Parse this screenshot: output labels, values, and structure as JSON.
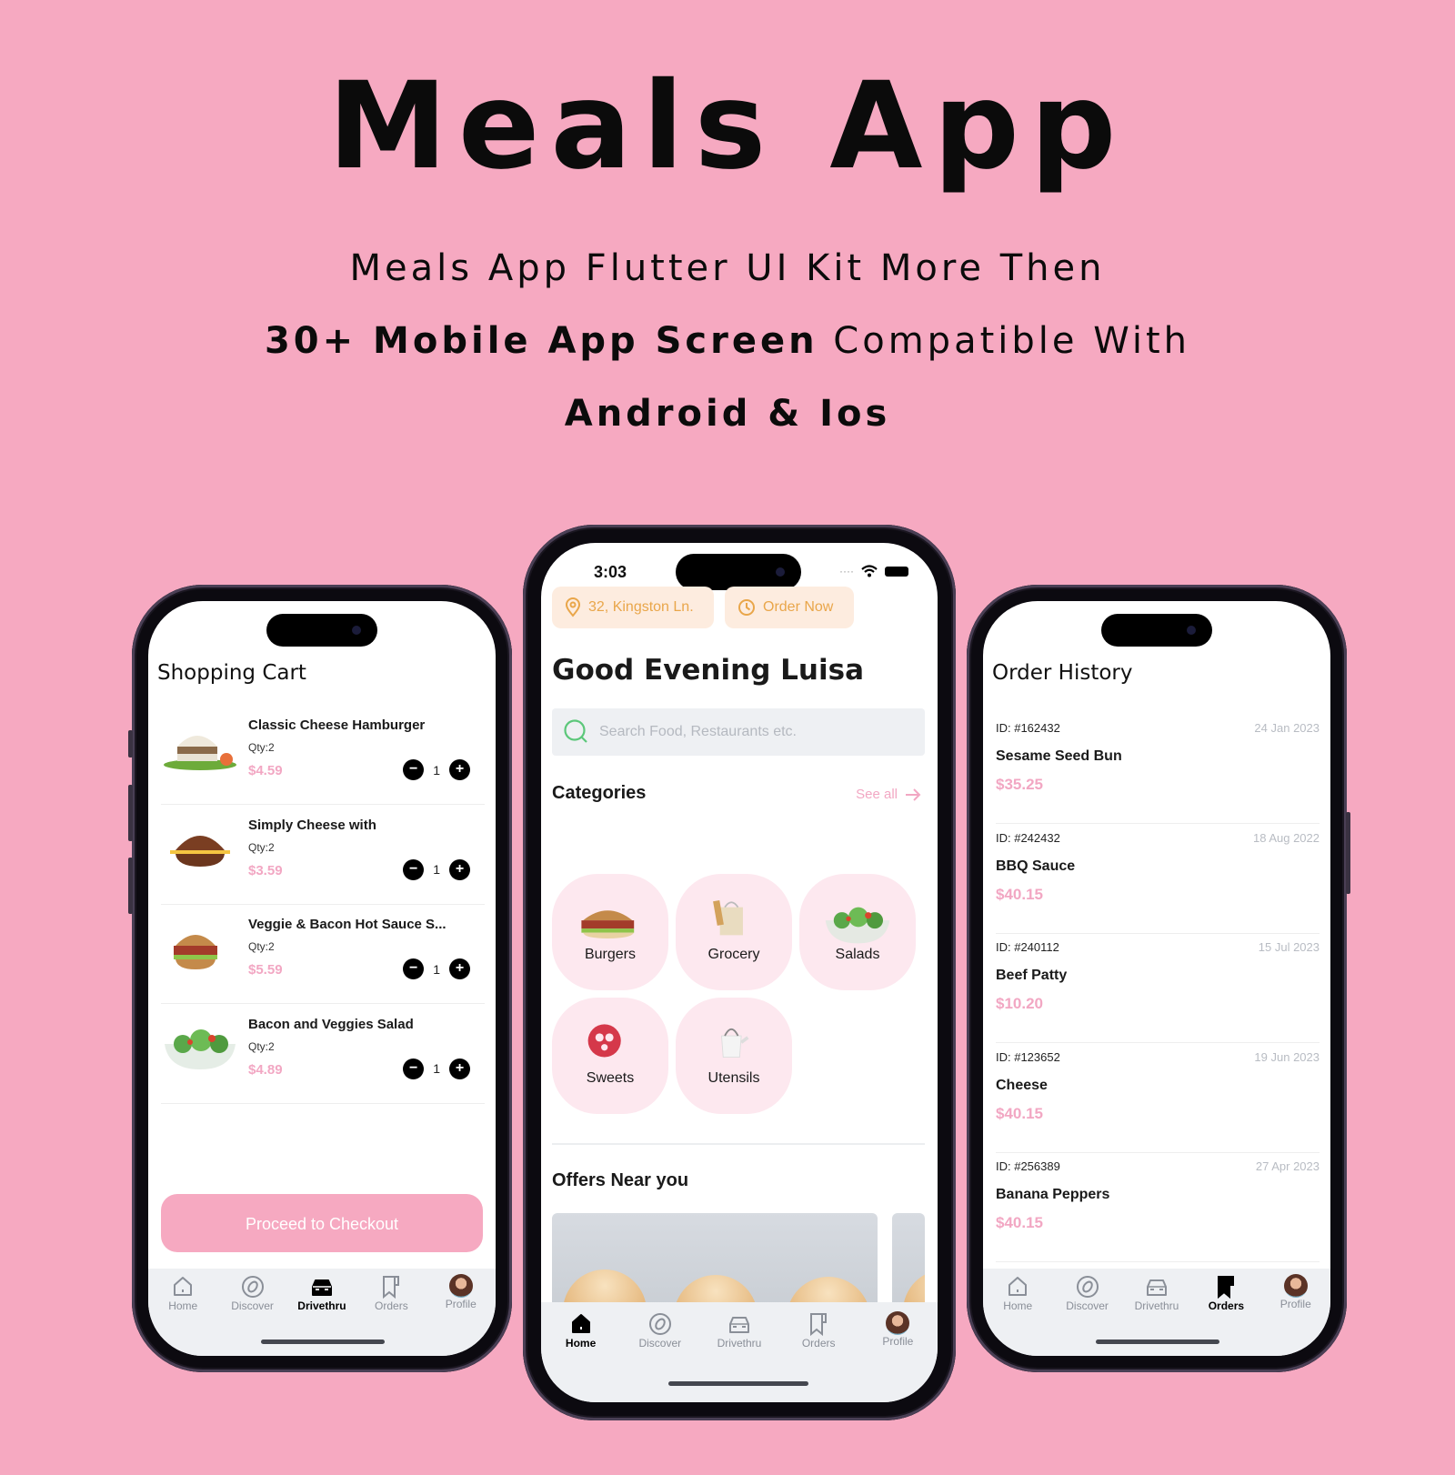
{
  "hero": {
    "title": "Meals App",
    "line1": "Meals App Flutter UI Kit More Then",
    "line2_bold": "30+ Mobile App Screen",
    "line2_rest": " Compatible With",
    "line3": "Android & Ios"
  },
  "colors": {
    "background": "#f6a9c1",
    "accent_pink": "#f2a7c3",
    "chip_orange": "#e9a64a",
    "search_icon_green": "#5cc77a"
  },
  "cart": {
    "title": "Shopping Cart",
    "items": [
      {
        "name": "Classic Cheese Hamburger",
        "qty": "Qty:2",
        "price": "$4.59",
        "count": "1",
        "image": "burger-with-salad"
      },
      {
        "name": "Simply Cheese with",
        "qty": "Qty:2",
        "price": "$3.59",
        "count": "1",
        "image": "cheese-bun"
      },
      {
        "name": "Veggie & Bacon Hot Sauce S...",
        "qty": "Qty:2",
        "price": "$5.59",
        "count": "1",
        "image": "veggie-burger"
      },
      {
        "name": "Bacon and Veggies Salad",
        "qty": "Qty:2",
        "price": "$4.89",
        "count": "1",
        "image": "salad-bowl"
      }
    ],
    "minus": "−",
    "plus": "+",
    "checkout_label": "Proceed to Checkout",
    "tabs": [
      {
        "label": "Home",
        "icon": "home-icon"
      },
      {
        "label": "Discover",
        "icon": "discover-icon"
      },
      {
        "label": "Drivethru",
        "icon": "car-icon",
        "active": true
      },
      {
        "label": "Orders",
        "icon": "orders-icon"
      },
      {
        "label": "Profile",
        "icon": "avatar"
      }
    ]
  },
  "home": {
    "status_time": "3:03",
    "location": "32, Kingston Ln.",
    "order_now": "Order Now",
    "greeting": "Good Evening Luisa",
    "search_placeholder": "Search Food, Restaurants etc.",
    "categories_title": "Categories",
    "see_all": "See all",
    "categories": [
      {
        "label": "Burgers",
        "image": "burger"
      },
      {
        "label": "Grocery",
        "image": "grocery-bag"
      },
      {
        "label": "Salads",
        "image": "salad-bowl"
      },
      {
        "label": "Sweets",
        "image": "pretzel-donut"
      },
      {
        "label": "Utensils",
        "image": "kettle"
      }
    ],
    "offers_title": "Offers Near you",
    "tabs": [
      {
        "label": "Home",
        "icon": "home-icon",
        "active": true
      },
      {
        "label": "Discover",
        "icon": "discover-icon"
      },
      {
        "label": "Drivethru",
        "icon": "car-icon"
      },
      {
        "label": "Orders",
        "icon": "orders-icon"
      },
      {
        "label": "Profile",
        "icon": "avatar"
      }
    ]
  },
  "orders": {
    "title": "Order History",
    "items": [
      {
        "id": "ID: #162432",
        "date": "24 Jan 2023",
        "name": "Sesame Seed Bun",
        "price": "$35.25"
      },
      {
        "id": "ID: #242432",
        "date": "18 Aug 2022",
        "name": "BBQ Sauce",
        "price": "$40.15"
      },
      {
        "id": "ID: #240112",
        "date": "15 Jul 2023",
        "name": "Beef Patty",
        "price": "$10.20"
      },
      {
        "id": "ID: #123652",
        "date": "19 Jun 2023",
        "name": "Cheese",
        "price": "$40.15"
      },
      {
        "id": "ID: #256389",
        "date": "27 Apr 2023",
        "name": "Banana Peppers",
        "price": "$40.15"
      }
    ],
    "tabs": [
      {
        "label": "Home",
        "icon": "home-icon"
      },
      {
        "label": "Discover",
        "icon": "discover-icon"
      },
      {
        "label": "Drivethru",
        "icon": "car-icon"
      },
      {
        "label": "Orders",
        "icon": "orders-icon",
        "active": true
      },
      {
        "label": "Profile",
        "icon": "avatar"
      }
    ]
  }
}
